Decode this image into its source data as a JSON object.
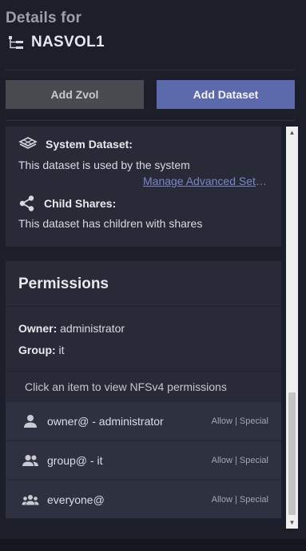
{
  "header": {
    "details_for": "Details for",
    "dataset_name": "NASVOL1",
    "dataset_icon": "tree-icon"
  },
  "actions": {
    "add_zvol": "Add Zvol",
    "add_dataset": "Add Dataset"
  },
  "system_dataset": {
    "icon": "database-icon",
    "title": "System Dataset:",
    "text": "This dataset is used by the system",
    "link": "Manage Advanced Settings"
  },
  "child_shares": {
    "icon": "share-icon",
    "title": "Child Shares:",
    "text": "This dataset has children with shares"
  },
  "permissions": {
    "title": "Permissions",
    "owner_label": "Owner:",
    "owner_value": "administrator",
    "group_label": "Group:",
    "group_value": "it",
    "hint": "Click an item to view NFSv4 permissions",
    "aces": [
      {
        "icon": "user-icon",
        "label": "owner@ - administrator",
        "type": "Allow | Special"
      },
      {
        "icon": "group-icon",
        "label": "group@ - it",
        "type": "Allow | Special"
      },
      {
        "icon": "everyone-icon",
        "label": "everyone@",
        "type": "Allow | Special"
      }
    ]
  },
  "colors": {
    "background": "#1c1e29",
    "card": "#282a37",
    "row": "#2e3140",
    "primary_button": "#5c6aac",
    "secondary_button": "#4a4b51",
    "link": "#7a86c8"
  }
}
